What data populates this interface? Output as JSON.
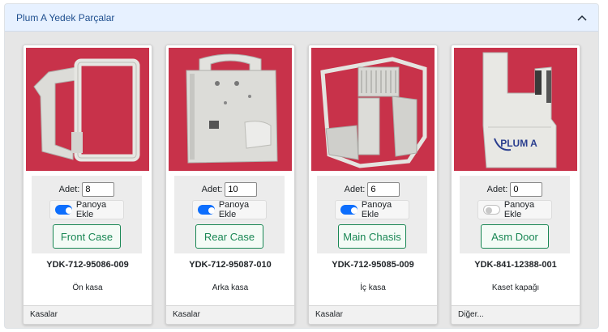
{
  "accordion": {
    "title": "Plum A Yedek Parçalar",
    "expanded": true
  },
  "labels": {
    "qty": "Adet:",
    "add_to_panel": "Panoya Ekle"
  },
  "colors": {
    "accent": "#0d6efd",
    "button": "#198754",
    "photo_bg": "#c8324a"
  },
  "cards": [
    {
      "quantity": "8",
      "add_to_panel": true,
      "button": "Front Case",
      "code": "YDK-712-95086-009",
      "description": "Ön kasa",
      "category": "Kasalar"
    },
    {
      "quantity": "10",
      "add_to_panel": true,
      "button": "Rear Case",
      "code": "YDK-712-95087-010",
      "description": "Arka kasa",
      "category": "Kasalar"
    },
    {
      "quantity": "6",
      "add_to_panel": true,
      "button": "Main Chasis",
      "code": "YDK-712-95085-009",
      "description": "İç kasa",
      "category": "Kasalar"
    },
    {
      "quantity": "0",
      "add_to_panel": false,
      "button": "Asm Door",
      "code": "YDK-841-12388-001",
      "description": "Kaset kapağı",
      "category": "Diğer...",
      "photo_text": "PLUM A"
    }
  ]
}
